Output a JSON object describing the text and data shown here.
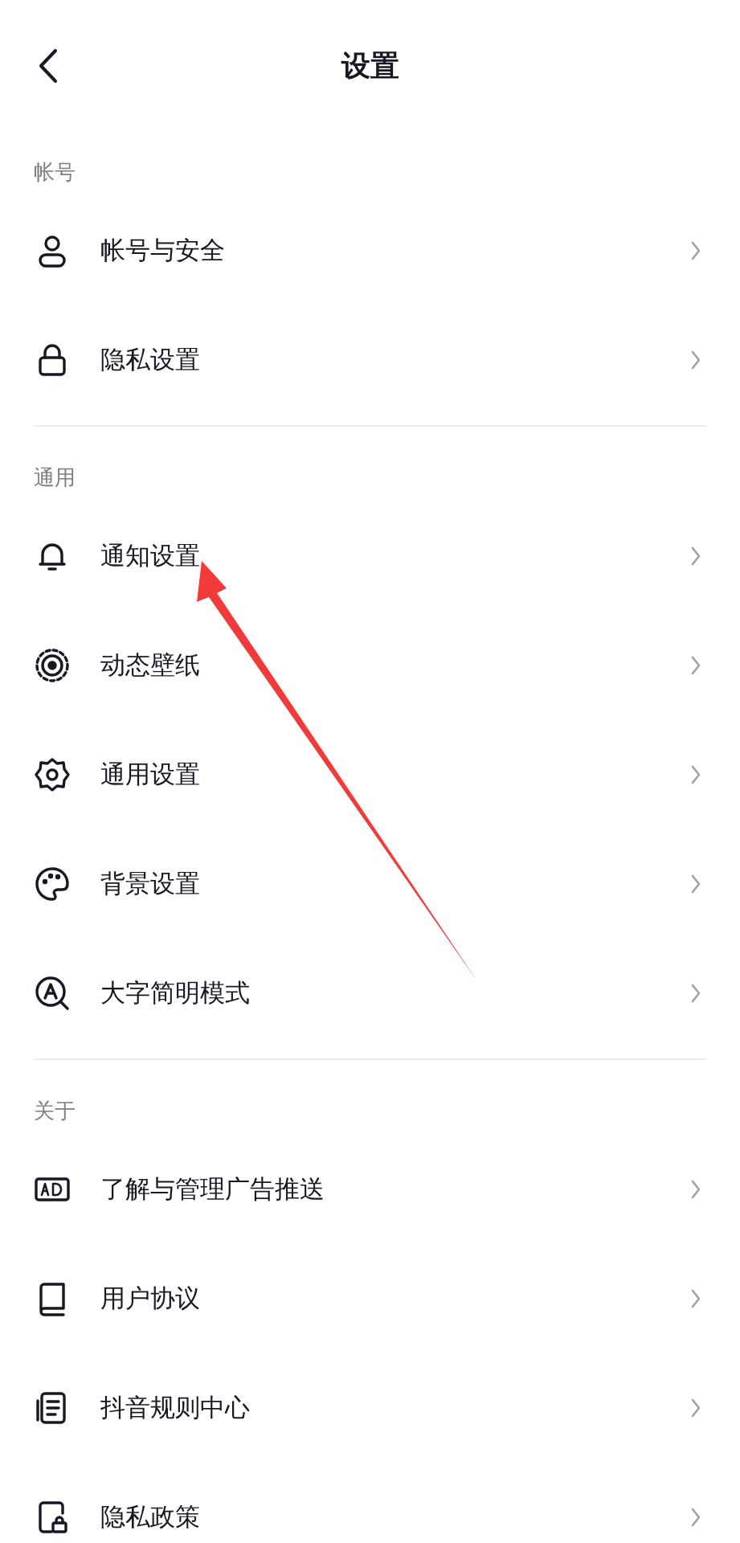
{
  "header": {
    "title": "设置"
  },
  "sections": [
    {
      "title": "帐号",
      "items": [
        {
          "kind": "user",
          "label": "帐号与安全"
        },
        {
          "kind": "lock",
          "label": "隐私设置"
        }
      ]
    },
    {
      "title": "通用",
      "items": [
        {
          "kind": "bell",
          "label": "通知设置"
        },
        {
          "kind": "ring",
          "label": "动态壁纸"
        },
        {
          "kind": "gear",
          "label": "通用设置"
        },
        {
          "kind": "palette",
          "label": "背景设置"
        },
        {
          "kind": "bigtext",
          "label": "大字简明模式"
        }
      ]
    },
    {
      "title": "关于",
      "items": [
        {
          "kind": "ad",
          "label": "了解与管理广告推送"
        },
        {
          "kind": "book",
          "label": "用户协议"
        },
        {
          "kind": "doc",
          "label": "抖音规则中心"
        },
        {
          "kind": "doclock",
          "label": "隐私政策"
        }
      ]
    }
  ],
  "annotation": {
    "kind": "arrow"
  }
}
